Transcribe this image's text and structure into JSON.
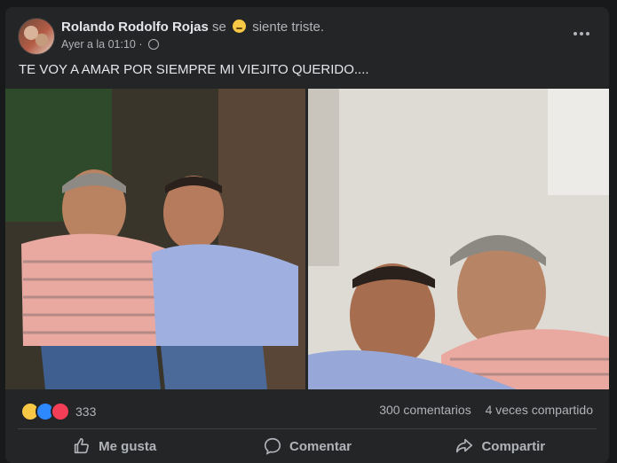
{
  "post": {
    "author": "Rolando Rodolfo Rojas",
    "feeling_prefix": "se",
    "feeling": "siente triste.",
    "timestamp": "Ayer a la 01:10 ·",
    "text": "TE VOY A AMAR POR SIEMPRE MI VIEJITO QUERIDO...."
  },
  "stats": {
    "reaction_count": "333",
    "comments": "300 comentarios",
    "shares": "4 veces compartido"
  },
  "actions": {
    "like": "Me gusta",
    "comment": "Comentar",
    "share": "Compartir"
  },
  "icons": {
    "feeling": "sad-face-icon",
    "privacy": "globe-icon",
    "more": "more-options-icon",
    "like": "thumbs-up-icon",
    "comment": "comment-bubble-icon",
    "share": "share-arrow-icon"
  },
  "colors": {
    "background": "#18191a",
    "card": "#242526",
    "primary_text": "#e4e6eb",
    "secondary_text": "#b0b3b8",
    "like_blue": "#2d88ff",
    "love_red": "#f33e58",
    "sad_yellow": "#f7c845"
  }
}
